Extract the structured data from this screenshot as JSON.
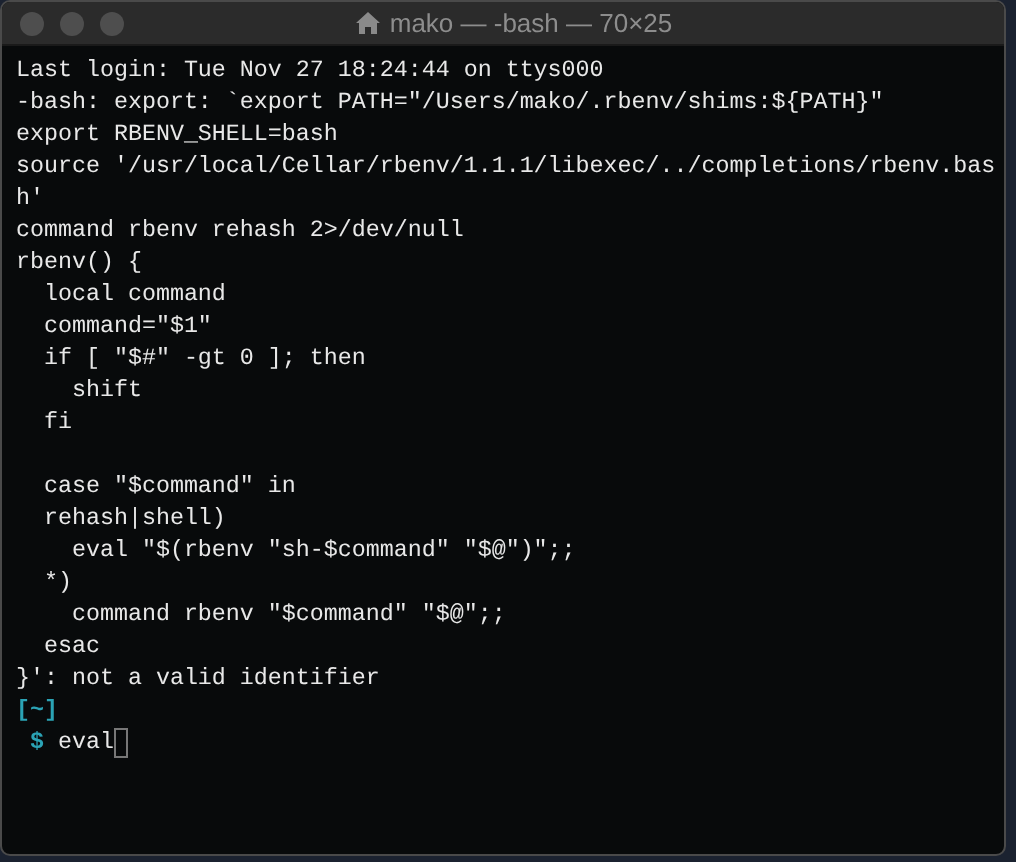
{
  "window": {
    "title": "mako — -bash — 70×25"
  },
  "lines": [
    {
      "kind": "output",
      "text": "Last login: Tue Nov 27 18:24:44 on ttys000"
    },
    {
      "kind": "output",
      "text": "-bash: export: `export PATH=\"/Users/mako/.rbenv/shims:${PATH}\""
    },
    {
      "kind": "output",
      "text": "export RBENV_SHELL=bash"
    },
    {
      "kind": "output",
      "text": "source '/usr/local/Cellar/rbenv/1.1.1/libexec/../completions/rbenv.bas"
    },
    {
      "kind": "output",
      "text": "h'"
    },
    {
      "kind": "output",
      "text": "command rbenv rehash 2>/dev/null"
    },
    {
      "kind": "output",
      "text": "rbenv() {"
    },
    {
      "kind": "output",
      "text": "  local command"
    },
    {
      "kind": "output",
      "text": "  command=\"$1\""
    },
    {
      "kind": "output",
      "text": "  if [ \"$#\" -gt 0 ]; then"
    },
    {
      "kind": "output",
      "text": "    shift"
    },
    {
      "kind": "output",
      "text": "  fi"
    },
    {
      "kind": "blank"
    },
    {
      "kind": "output",
      "text": "  case \"$command\" in"
    },
    {
      "kind": "output",
      "text": "  rehash|shell)"
    },
    {
      "kind": "output",
      "text": "    eval \"$(rbenv \"sh-$command\" \"$@\")\";;"
    },
    {
      "kind": "output",
      "text": "  *)"
    },
    {
      "kind": "output",
      "text": "    command rbenv \"$command\" \"$@\";;"
    },
    {
      "kind": "output",
      "text": "  esac"
    },
    {
      "kind": "output",
      "text": "}': not a valid identifier"
    },
    {
      "kind": "cwd",
      "text": "[~]"
    },
    {
      "kind": "prompt",
      "symbol": "$",
      "input": "eval"
    }
  ]
}
